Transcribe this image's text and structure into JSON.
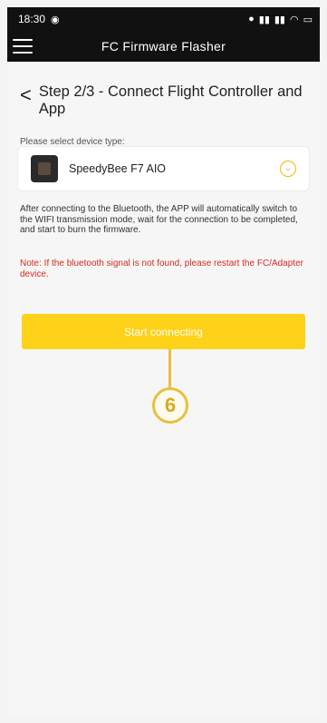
{
  "status_bar": {
    "time": "18:30",
    "left_icon": "media-icon",
    "right_icons": [
      "notification-icon",
      "signal-icon",
      "signal-icon",
      "wifi-icon",
      "battery-icon"
    ]
  },
  "app_bar": {
    "title": "FC Firmware Flasher",
    "menu_icon": "hamburger-icon"
  },
  "step": {
    "back_glyph": "<",
    "title": "Step 2/3 - Connect Flight Controller and App"
  },
  "device": {
    "label": "Please select device type:",
    "selected": "SpeedyBee F7 AIO",
    "thumbnail_icon": "flight-controller-icon",
    "chevron_icon": "chevron-down-icon"
  },
  "info_text": "After connecting to the Bluetooth, the APP will automatically switch to the WIFI transmission mode, wait for the connection to be completed, and start to burn the firmware.",
  "note_text": "Note: If the bluetooth signal is not found, please restart the FC/Adapter device.",
  "start_button": {
    "label": "Start connecting"
  },
  "marker": {
    "number": "6"
  },
  "colors": {
    "accent": "#fdd218",
    "bar_bg": "#111111",
    "note": "#d42a1e",
    "marker": "#e8c040"
  }
}
